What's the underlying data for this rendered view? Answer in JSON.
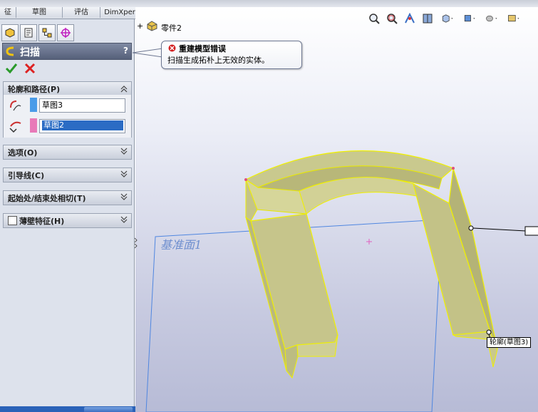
{
  "tabs": [
    {
      "label": "征"
    },
    {
      "label": "草图"
    },
    {
      "label": "评估"
    },
    {
      "label": "DimXpert"
    }
  ],
  "tree": {
    "part_label": "零件2"
  },
  "property_manager": {
    "title": "扫描",
    "help_label": "?",
    "groups": {
      "profile_path": "轮廓和路径(P)",
      "options": "选项(O)",
      "guide_curves": "引导线(C)",
      "tangency": "起始处/结束处相切(T)",
      "thin_feature": "薄壁特征(H)"
    },
    "profile_value": "草图3",
    "path_value": "草图2",
    "profile_color": "#4a9be8",
    "path_color": "#e87ab8"
  },
  "error": {
    "title": "重建模型错误",
    "message": "扫描生成拓朴上无效的实体。"
  },
  "viewport": {
    "plane_label": "基准面1",
    "profile_tag": "轮廓(草图3)"
  },
  "icons": [
    "zoom-to-fit-icon",
    "zoom-area-icon",
    "previous-view-icon",
    "section-view-icon",
    "view-orientation-icon",
    "display-style-icon",
    "hide-show-icon",
    "scene-icon"
  ]
}
